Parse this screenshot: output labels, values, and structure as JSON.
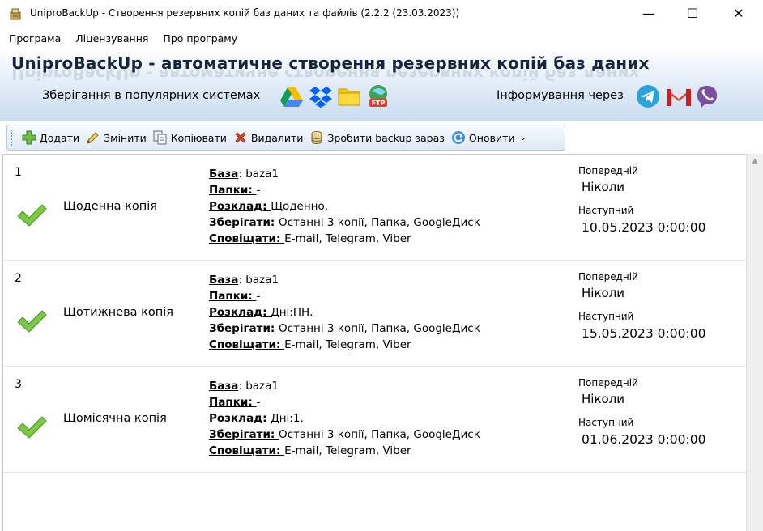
{
  "window": {
    "title": "UniproBackUp - Створення резервних копій баз даних та файлів (2.2.2 (23.03.2023))",
    "minimize": "—",
    "maximize": "☐",
    "close": "✕"
  },
  "menu": [
    "Програма",
    "Ліцензування",
    "Про програму"
  ],
  "banner": {
    "title": "UniproBackUp - автоматичне створення резервних копій баз даних",
    "storage_text": "Зберігання в популярних системах",
    "storage_icons": [
      "google-drive-icon",
      "dropbox-icon",
      "folder-icon",
      "ftp-icon"
    ],
    "ftp_label": "FTP",
    "notify_text": "Інформування через",
    "notify_icons": [
      "telegram-icon",
      "gmail-icon",
      "viber-icon"
    ]
  },
  "toolbar": {
    "add": "Додати",
    "edit": "Змінити",
    "copy": "Копіювати",
    "delete": "Видалити",
    "backup_now": "Зробити backup зараз",
    "refresh": "Оновити",
    "more": "⌄"
  },
  "labels": {
    "base": "База",
    "folders": "Папки: ",
    "schedule": "Розклад: ",
    "store": "Зберігати: ",
    "notify": "Сповіщати: ",
    "previous": "Попередній",
    "next": "Наступний"
  },
  "jobs": [
    {
      "num": "1",
      "name": "Щоденна копія",
      "base": ": baza1",
      "folders": "-",
      "schedule": " Щоденно.",
      "store": " Останні 3 копії, Папка, GoogleДиск",
      "notify": "E-mail, Telegram, Viber",
      "previous": "Ніколи",
      "next": "10.05.2023 0:00:00"
    },
    {
      "num": "2",
      "name": "Щотижнева копія",
      "base": ": baza1",
      "folders": "-",
      "schedule": " Дні:ПН.",
      "store": " Останні 3 копії, Папка, GoogleДиск",
      "notify": "E-mail, Telegram, Viber",
      "previous": "Ніколи",
      "next": "15.05.2023 0:00:00"
    },
    {
      "num": "3",
      "name": "Щомісячна копія",
      "base": ": baza1",
      "folders": "-",
      "schedule": " Дні:1.",
      "store": " Останні 3 копії, Папка, GoogleДиск",
      "notify": "E-mail, Telegram, Viber",
      "previous": "Ніколи",
      "next": "01.06.2023 0:00:00"
    }
  ],
  "colors": {
    "banner_title": "#16253d",
    "check": "#7ac943",
    "toolbar_border": "#b7c9e0"
  }
}
